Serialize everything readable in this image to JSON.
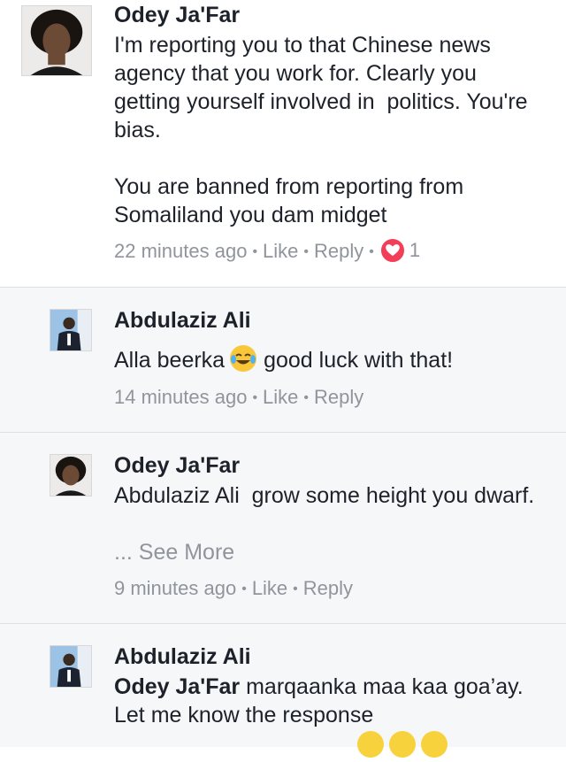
{
  "comments": [
    {
      "author": "Odey Ja'Far",
      "text": "I'm reporting you to that Chinese news agency that you work for. Clearly you getting yourself involved in  politics. You're bias.\n\nYou are banned from reporting from Somaliland you dam midget",
      "time": "22 minutes ago",
      "like": "Like",
      "reply": "Reply",
      "reaction": {
        "icon": "heart-icon",
        "count": "1",
        "color": "#f33e58"
      }
    },
    {
      "author": "Abdulaziz Ali",
      "text_before": "Alla beerka",
      "emoji": "face-with-tears-of-joy-icon",
      "text_after": "good luck with that!",
      "time": "14 minutes ago",
      "like": "Like",
      "reply": "Reply"
    },
    {
      "author": "Odey Ja'Far",
      "text": "Abdulaziz Ali  grow some height you dwarf.",
      "see_more": "... See More",
      "time": "9 minutes ago",
      "like": "Like",
      "reply": "Reply"
    },
    {
      "author": "Abdulaziz Ali",
      "mention": "Odey Ja'Far",
      "text": " marqaanka maa kaa goa’ay. Let me know the response"
    }
  ],
  "colors": {
    "name": "#1d2129",
    "meta": "#90949c",
    "reply_bg": "#f6f7f9",
    "divider": "#dddfe2"
  }
}
